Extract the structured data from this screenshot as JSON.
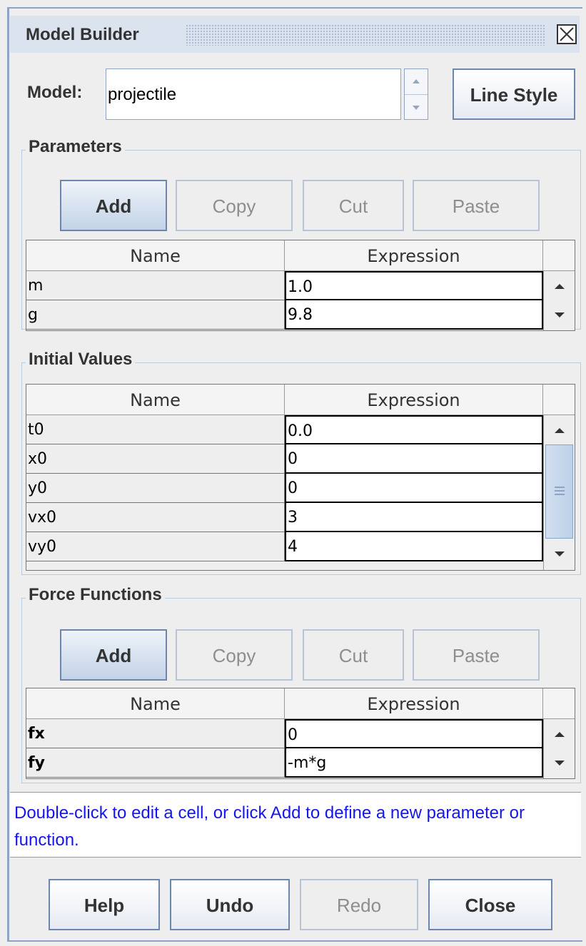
{
  "window": {
    "title": "Model Builder",
    "close_icon": "close-box-icon"
  },
  "model": {
    "label": "Model:",
    "value": "projectile",
    "line_style_label": "Line Style"
  },
  "parameters": {
    "title": "Parameters",
    "buttons": {
      "add": "Add",
      "copy": "Copy",
      "cut": "Cut",
      "paste": "Paste"
    },
    "columns": [
      "Name",
      "Expression"
    ],
    "rows": [
      {
        "name": "m",
        "expression": "1.0"
      },
      {
        "name": "g",
        "expression": "9.8"
      }
    ]
  },
  "initial_values": {
    "title": "Initial Values",
    "columns": [
      "Name",
      "Expression"
    ],
    "rows": [
      {
        "name": "t0",
        "expression": "0.0"
      },
      {
        "name": "x0",
        "expression": "0"
      },
      {
        "name": "y0",
        "expression": "0"
      },
      {
        "name": "vx0",
        "expression": "3"
      },
      {
        "name": "vy0",
        "expression": "4"
      }
    ]
  },
  "force_functions": {
    "title": "Force Functions",
    "buttons": {
      "add": "Add",
      "copy": "Copy",
      "cut": "Cut",
      "paste": "Paste"
    },
    "columns": [
      "Name",
      "Expression"
    ],
    "rows": [
      {
        "name": "fx",
        "expression": "0"
      },
      {
        "name": "fy",
        "expression": "-m*g"
      }
    ]
  },
  "hint": "Double-click to edit a cell, or click Add to define a new parameter or function.",
  "footer": {
    "help": "Help",
    "undo": "Undo",
    "redo": "Redo",
    "close": "Close"
  },
  "colors": {
    "accent_border": "#6d86ad",
    "hint_text": "#1515ee",
    "frame": "#8ea4c4"
  }
}
